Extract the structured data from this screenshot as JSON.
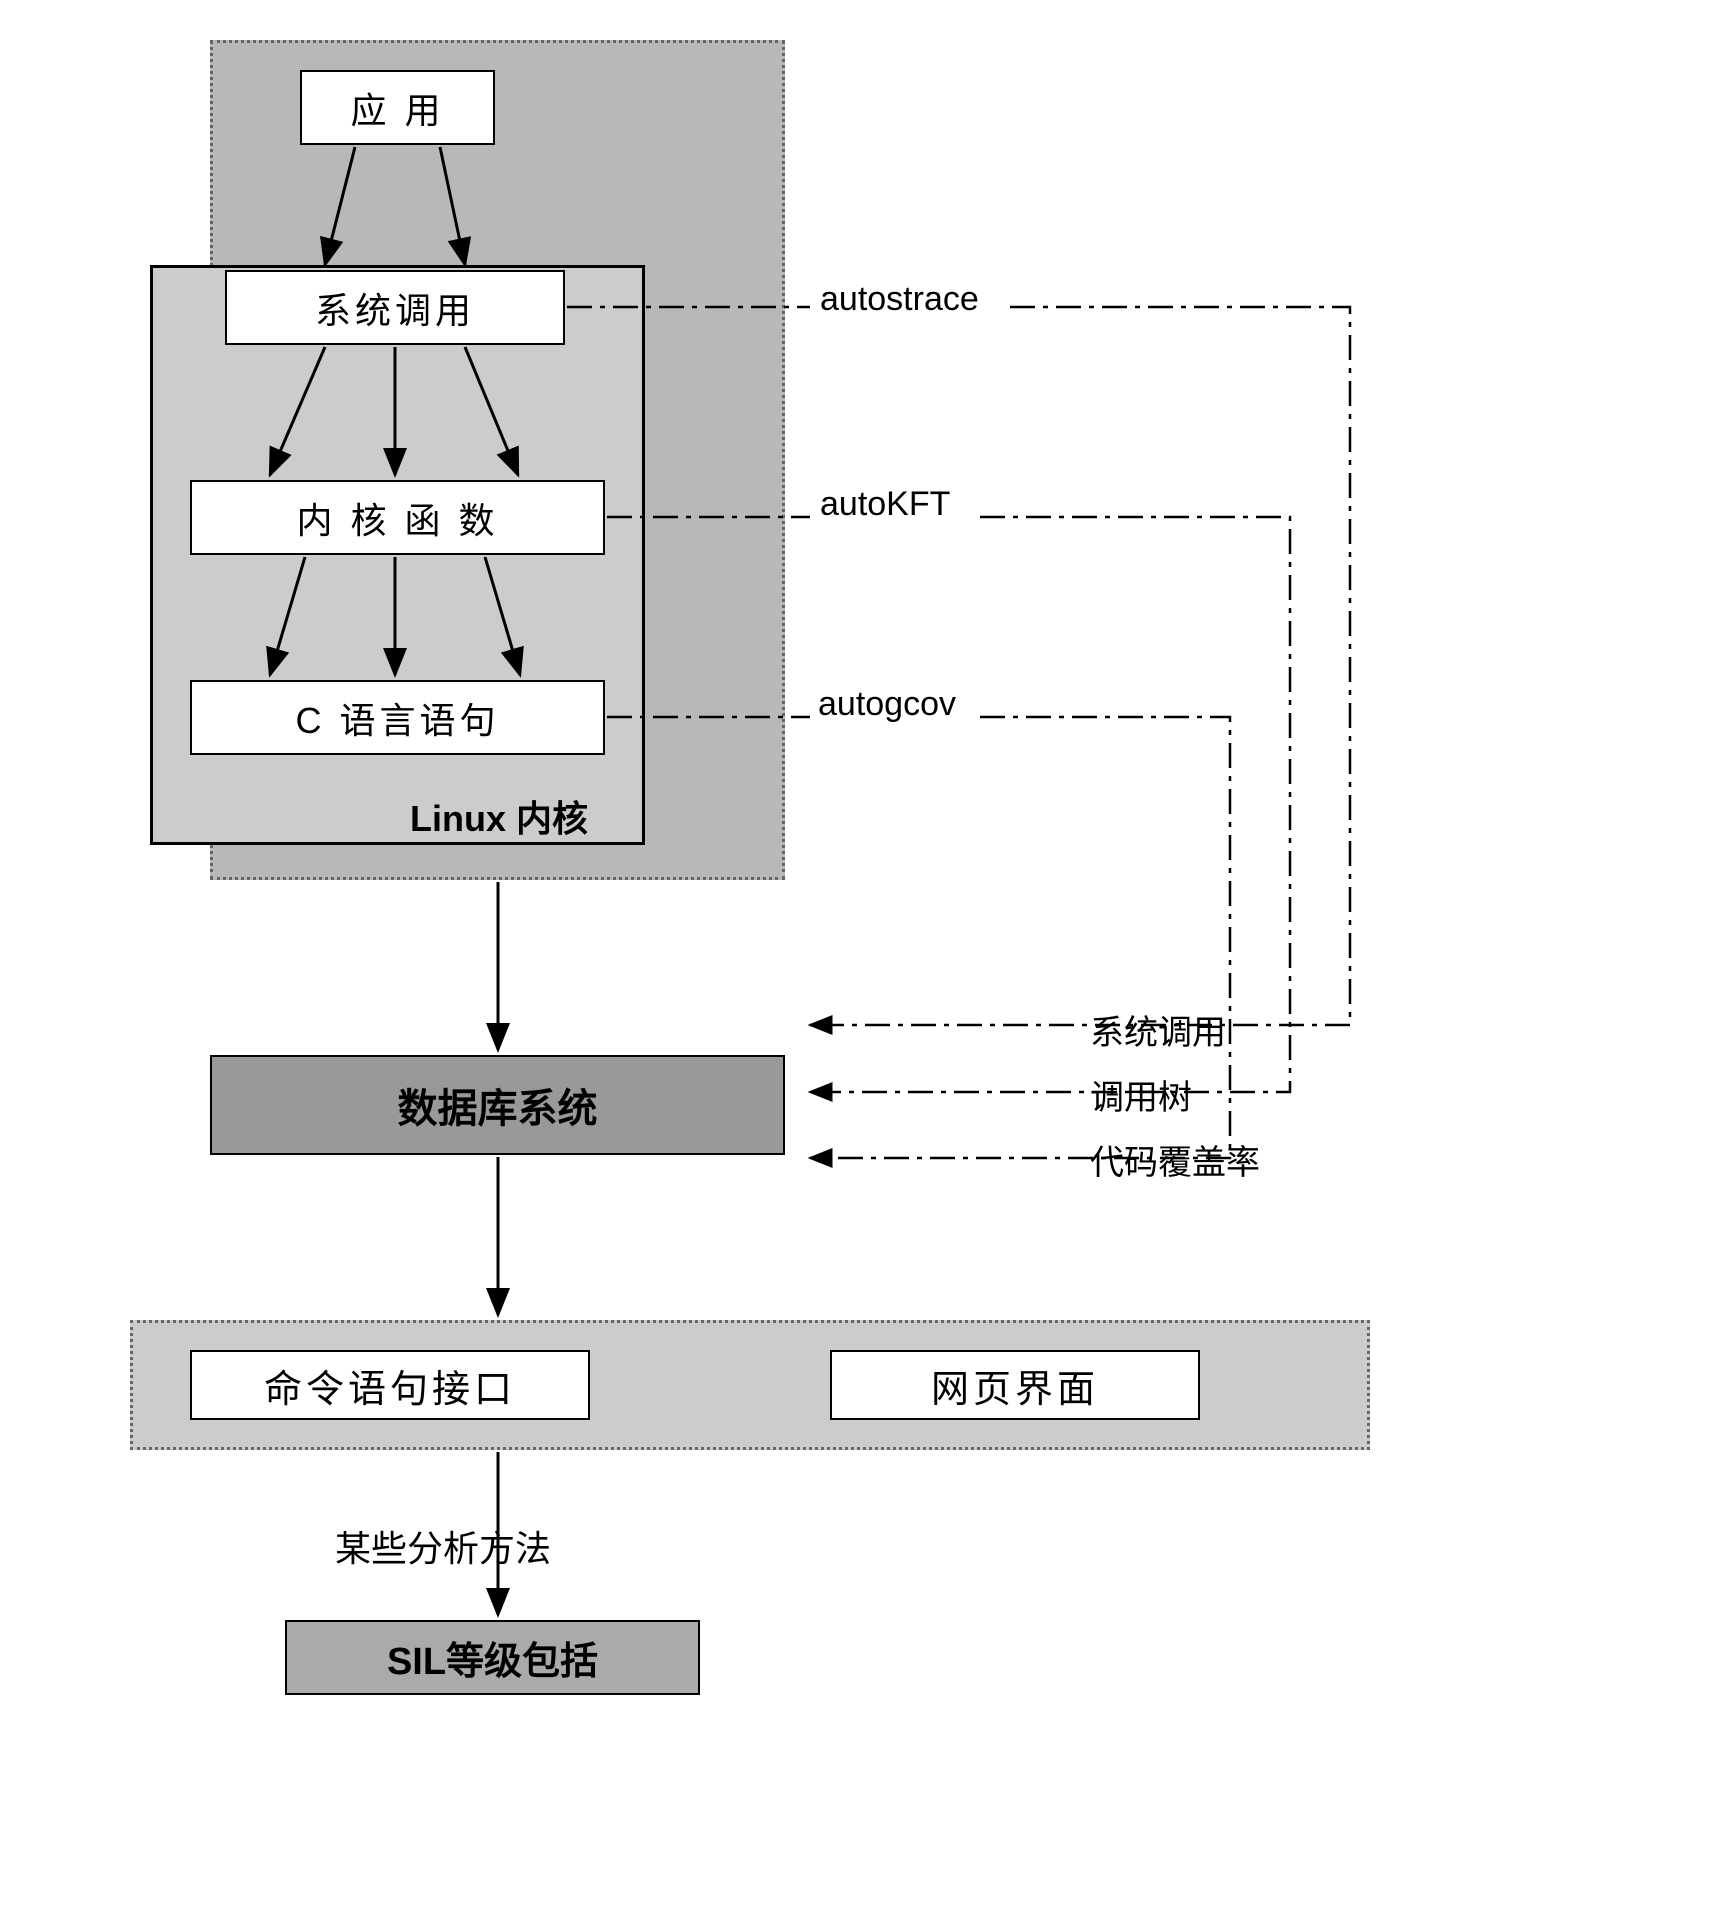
{
  "boxes": {
    "app": "应 用",
    "syscall": "系统调用",
    "kernfunc": "内 核 函 数",
    "cstatement": "C 语言语句",
    "linux_kernel": "Linux 内核",
    "database": "数据库系统",
    "cmd_interface": "命令语句接口",
    "web_interface": "网页界面",
    "sil": "SIL等级包括"
  },
  "tool_labels": {
    "autostrace": "autostrace",
    "autokft": "autoKFT",
    "autogcov": "autogcov"
  },
  "db_inputs": {
    "syscall": "系统调用",
    "calltree": "调用树",
    "coverage": "代码覆盖率"
  },
  "annotations": {
    "analysis_method": "某些分析方法"
  }
}
